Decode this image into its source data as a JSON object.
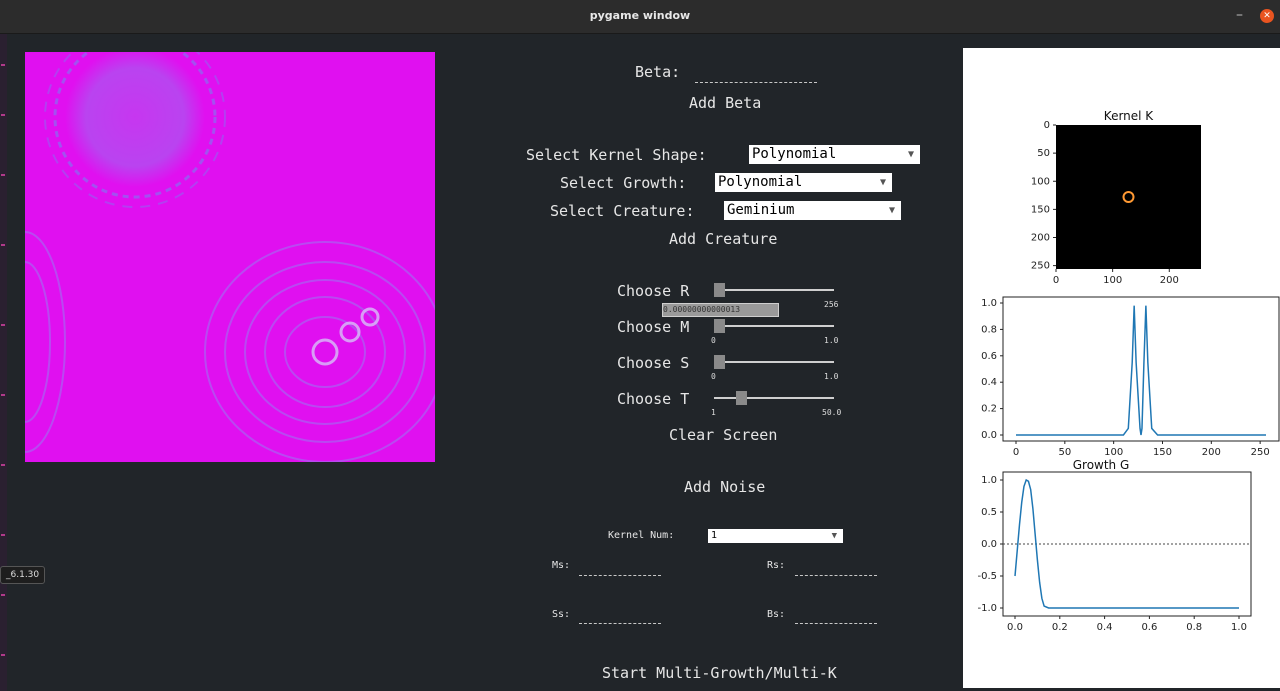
{
  "window": {
    "title": "pygame window"
  },
  "tooltip": {
    "text": "_6.1.30"
  },
  "controls": {
    "beta_label": "Beta:",
    "beta_value": "",
    "add_beta": "Add Beta",
    "kernel_shape_label": "Select Kernel Shape:",
    "kernel_shape_value": "Polynomial",
    "growth_label": "Select Growth:",
    "growth_value": "Polynomial",
    "creature_label": "Select Creature:",
    "creature_value": "Geminium",
    "add_creature": "Add Creature",
    "sliders": [
      {
        "label": "Choose R",
        "min": "",
        "max": "256",
        "fraction": 0.0
      },
      {
        "label": "Choose M",
        "min": "0",
        "max": "1.0",
        "fraction": 0.0
      },
      {
        "label": "Choose S",
        "min": "0",
        "max": "1.0",
        "fraction": 0.0
      },
      {
        "label": "Choose T",
        "min": "1",
        "max": "50.0",
        "fraction": 0.2
      }
    ],
    "r_value_box": "0.00000000000013",
    "clear_screen": "Clear Screen",
    "add_noise": "Add Noise",
    "kernel_num_label": "Kernel Num:",
    "kernel_num_value": "1",
    "ms_label": "Ms:",
    "rs_label": "Rs:",
    "ss_label": "Ss:",
    "bs_label": "Bs:",
    "start_multi": "Start Multi-Growth/Multi-K"
  },
  "colors": {
    "simulation": "#e010f0",
    "plot_line": "#1f77b4",
    "kernel_dot": "#ff9933"
  },
  "chart_data": [
    {
      "type": "heatmap",
      "title": "Kernel K",
      "xticks": [
        "0",
        "100",
        "200"
      ],
      "yticks": [
        "0",
        "50",
        "100",
        "150",
        "200",
        "250"
      ],
      "xlim": [
        0,
        256
      ],
      "ylim": [
        256,
        0
      ],
      "features": [
        {
          "x": 128,
          "y": 128,
          "description": "ring"
        }
      ]
    },
    {
      "type": "line",
      "title": "",
      "xticks": [
        "0",
        "50",
        "100",
        "150",
        "200",
        "250"
      ],
      "yticks": [
        "0.0",
        "0.2",
        "0.4",
        "0.6",
        "0.8",
        "1.0"
      ],
      "xlim": [
        0,
        256
      ],
      "ylim": [
        0,
        1.0
      ],
      "x": [
        0,
        110,
        115,
        119,
        121,
        123,
        127,
        128,
        129,
        131,
        133,
        135,
        139,
        145,
        256
      ],
      "y": [
        0,
        0,
        0.05,
        0.55,
        0.98,
        0.55,
        0.05,
        0.0,
        0.05,
        0.55,
        0.98,
        0.55,
        0.05,
        0,
        0
      ]
    },
    {
      "type": "line",
      "title": "Growth G",
      "xticks": [
        "0.0",
        "0.2",
        "0.4",
        "0.6",
        "0.8",
        "1.0"
      ],
      "yticks": [
        "1.0",
        "0.5",
        "0.0",
        "-0.5",
        "-1.0"
      ],
      "xlim": [
        0,
        1.0
      ],
      "ylim": [
        -1.0,
        1.0
      ],
      "hline": 0.0,
      "x": [
        0.0,
        0.01,
        0.02,
        0.03,
        0.04,
        0.05,
        0.06,
        0.07,
        0.08,
        0.09,
        0.1,
        0.11,
        0.12,
        0.13,
        0.15,
        0.2,
        0.5,
        1.0
      ],
      "y": [
        -0.5,
        -0.1,
        0.3,
        0.65,
        0.9,
        1.0,
        0.98,
        0.85,
        0.55,
        0.15,
        -0.25,
        -0.6,
        -0.85,
        -0.97,
        -1.0,
        -1.0,
        -1.0,
        -1.0
      ]
    }
  ]
}
